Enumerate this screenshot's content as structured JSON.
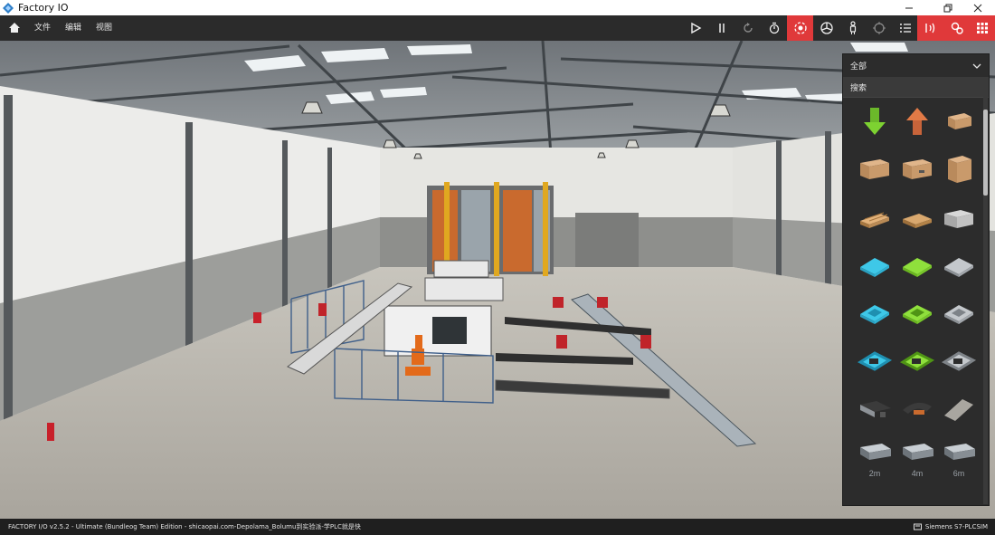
{
  "window": {
    "title": "Factory IO"
  },
  "menu": {
    "home_icon": "home-icon",
    "items": [
      "文件",
      "编辑",
      "视图"
    ]
  },
  "toolbar": {
    "buttons": [
      "play-icon",
      "pause-icon",
      "reset-icon",
      "timer-icon",
      "camera-orbit-icon",
      "camera-fly-icon",
      "first-person-icon",
      "selection-icon",
      "tag-list-icon",
      "sensors-icon",
      "drivers-icon",
      "palette-icon"
    ],
    "active_color": "#e0393a"
  },
  "panel": {
    "category": "全部",
    "search_label": "搜索",
    "parts": [
      {
        "icon": "emitter-icon",
        "sub": ""
      },
      {
        "icon": "remover-icon",
        "sub": ""
      },
      {
        "icon": "small-box-icon",
        "sub": ""
      },
      {
        "icon": "medium-box-icon",
        "sub": ""
      },
      {
        "icon": "large-box-icon",
        "sub": ""
      },
      {
        "icon": "tall-box-icon",
        "sub": ""
      },
      {
        "icon": "pallet-icon",
        "sub": ""
      },
      {
        "icon": "square-pallet-icon",
        "sub": ""
      },
      {
        "icon": "stackable-box-icon",
        "sub": ""
      },
      {
        "icon": "blue-raw-material-icon",
        "sub": ""
      },
      {
        "icon": "green-raw-material-icon",
        "sub": ""
      },
      {
        "icon": "metal-raw-material-icon",
        "sub": ""
      },
      {
        "icon": "blue-product-base-icon",
        "sub": ""
      },
      {
        "icon": "green-product-base-icon",
        "sub": ""
      },
      {
        "icon": "metal-product-base-icon",
        "sub": ""
      },
      {
        "icon": "blue-product-lid-icon",
        "sub": ""
      },
      {
        "icon": "green-product-lid-icon",
        "sub": ""
      },
      {
        "icon": "metal-product-lid-icon",
        "sub": ""
      },
      {
        "icon": "belt-conveyor-icon",
        "sub": ""
      },
      {
        "icon": "curved-belt-icon",
        "sub": ""
      },
      {
        "icon": "floor-plate-icon",
        "sub": ""
      },
      {
        "icon": "roller-conveyor-2m-icon",
        "sub": "2m"
      },
      {
        "icon": "roller-conveyor-4m-icon",
        "sub": "4m"
      },
      {
        "icon": "roller-conveyor-6m-icon",
        "sub": "6m"
      },
      {
        "icon": "roller-curve-icon",
        "sub": ""
      },
      {
        "icon": "chain-transfer-icon",
        "sub": ""
      },
      {
        "icon": "slide-icon",
        "sub": ""
      }
    ]
  },
  "status": {
    "text": "FACTORY I/O v2.5.2 - Ultimate (Bundleog Team) Edition - shicaopai.com-Depolama_Bolumu到实验派-学PLC就是快",
    "driver": "Siemens S7-PLCSIM"
  },
  "colors": {
    "accent": "#e0393a",
    "chrome": "#2b2b2b",
    "statusbar": "#1f1f1f"
  }
}
